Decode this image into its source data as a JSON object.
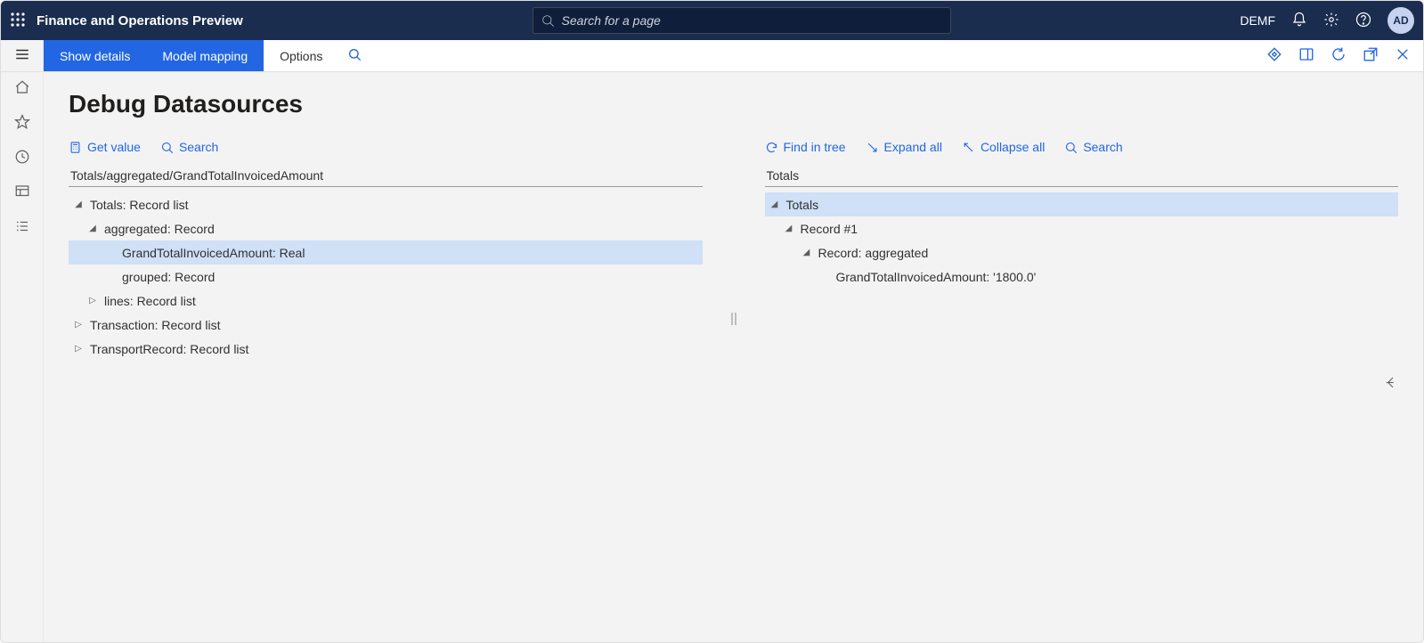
{
  "header": {
    "app_title": "Finance and Operations Preview",
    "search_placeholder": "Search for a page",
    "company": "DEMF",
    "avatar_initials": "AD"
  },
  "ribbon": {
    "show_details": "Show details",
    "model_mapping": "Model mapping",
    "options": "Options"
  },
  "page": {
    "title": "Debug Datasources"
  },
  "left_panel": {
    "toolbar": {
      "get_value": "Get value",
      "search": "Search"
    },
    "path": "Totals/aggregated/GrandTotalInvoicedAmount",
    "tree": {
      "n0": "Totals: Record list",
      "n1": "aggregated: Record",
      "n2": "GrandTotalInvoicedAmount: Real",
      "n3": "grouped: Record",
      "n4": "lines: Record list",
      "n5": "Transaction: Record list",
      "n6": "TransportRecord: Record list"
    }
  },
  "right_panel": {
    "toolbar": {
      "find_in_tree": "Find in tree",
      "expand_all": "Expand all",
      "collapse_all": "Collapse all",
      "search": "Search"
    },
    "path": "Totals",
    "tree": {
      "n0": "Totals",
      "n1": "Record #1",
      "n2": "Record: aggregated",
      "n3": "GrandTotalInvoicedAmount: '1800.0'"
    }
  }
}
